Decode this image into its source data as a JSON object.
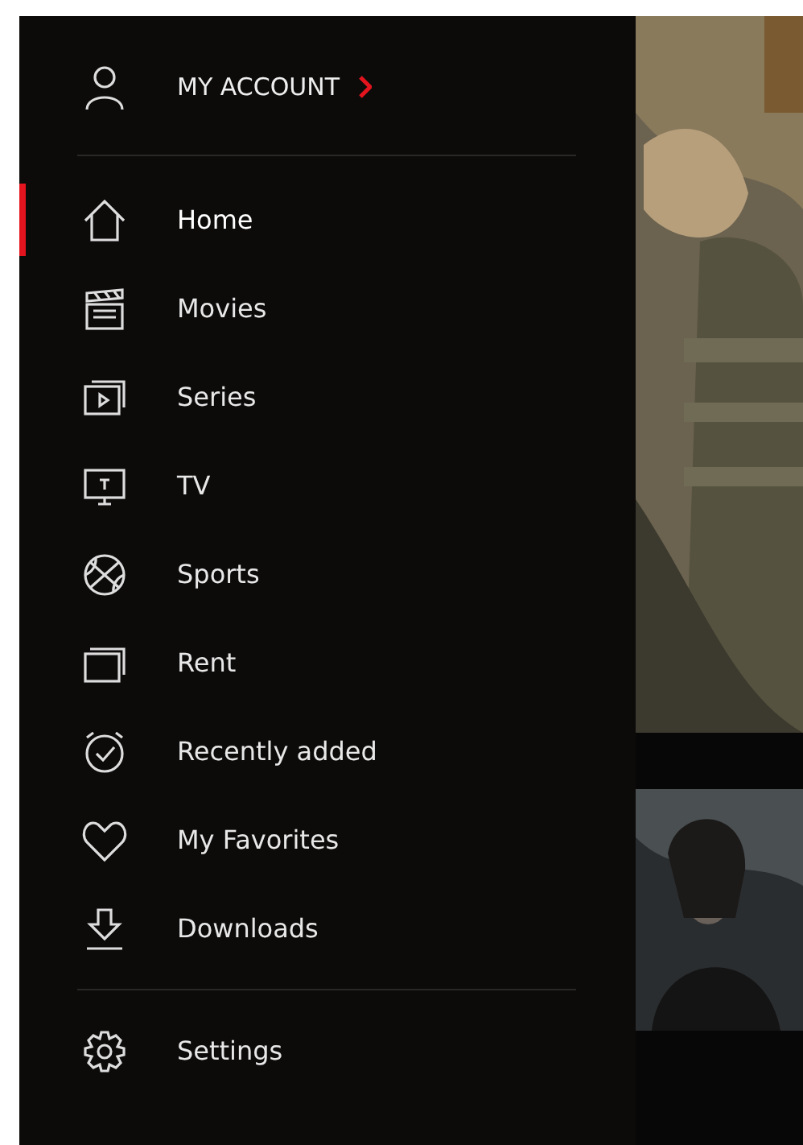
{
  "account": {
    "label": "MY ACCOUNT"
  },
  "menu": {
    "items": [
      {
        "label": "Home",
        "selected": true
      },
      {
        "label": "Movies",
        "selected": false
      },
      {
        "label": "Series",
        "selected": false
      },
      {
        "label": "TV",
        "selected": false
      },
      {
        "label": "Sports",
        "selected": false
      },
      {
        "label": "Rent",
        "selected": false
      },
      {
        "label": "Recently added",
        "selected": false
      },
      {
        "label": "My Favorites",
        "selected": false
      },
      {
        "label": "Downloads",
        "selected": false
      }
    ]
  },
  "settings": {
    "label": "Settings",
    "selected": false
  }
}
